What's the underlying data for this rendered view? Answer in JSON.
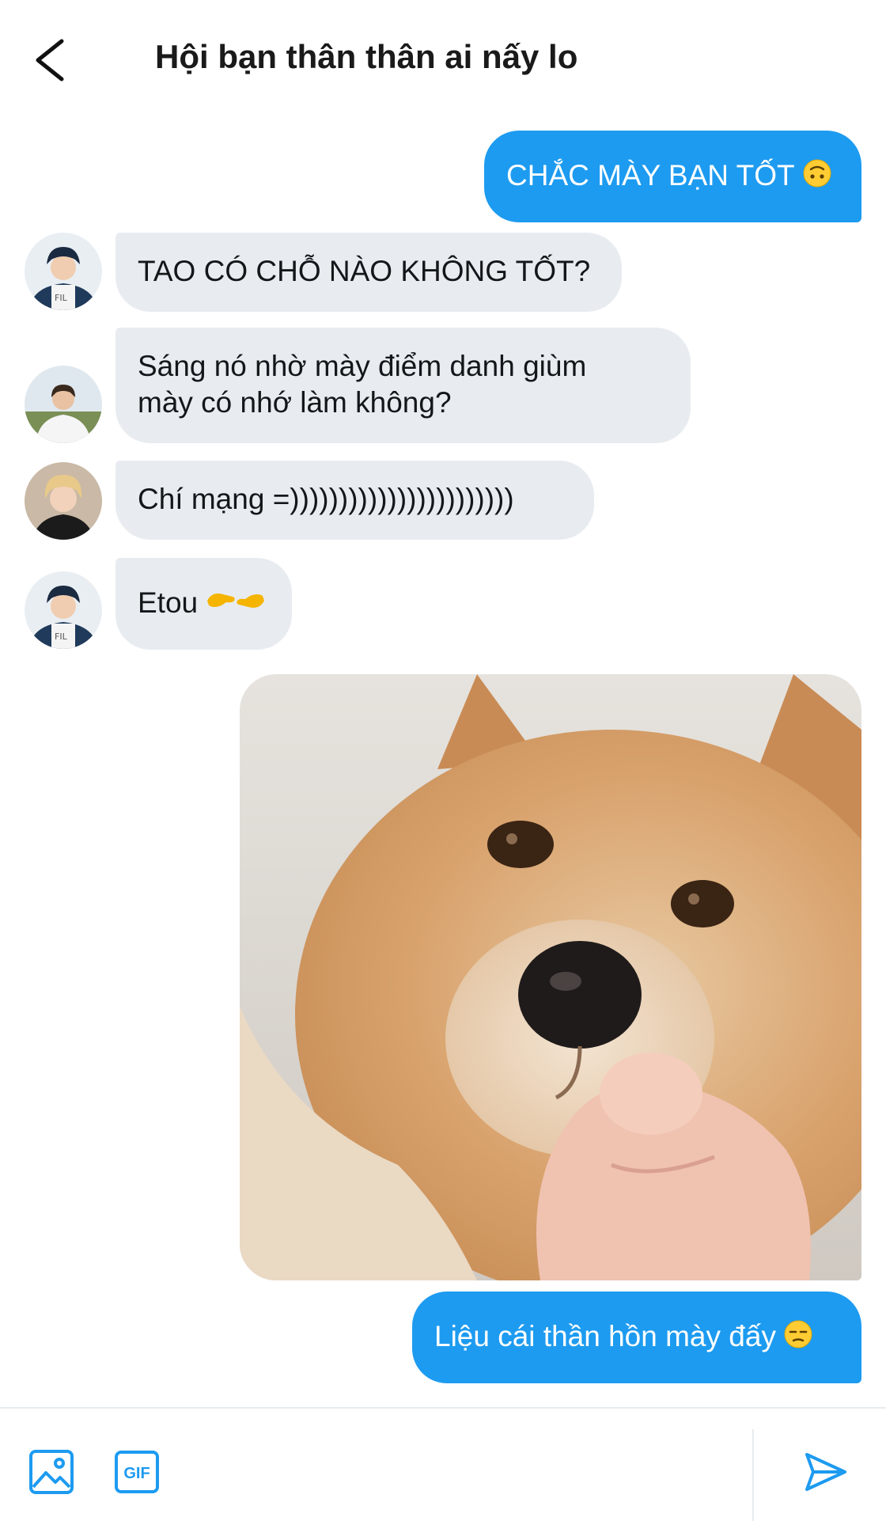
{
  "header": {
    "title": "Hội bạn thân thân ai nấy lo"
  },
  "messages": [
    {
      "sender": "me",
      "text": "CHẮC MÀY BẠN TỐT",
      "emoji": "upside-down-face"
    },
    {
      "sender": "member-1",
      "text": "TAO CÓ CHỖ NÀO KHÔNG TỐT?"
    },
    {
      "sender": "member-2",
      "line1": "Sáng nó nhờ mày điểm danh giùm",
      "line2": "mày có nhớ làm không?"
    },
    {
      "sender": "member-3",
      "text": "Chí mạng =)))))))))))))))))))))))"
    },
    {
      "sender": "member-1",
      "text": "Etou",
      "emoji": "pointing-fingers"
    },
    {
      "sender": "me",
      "type": "image",
      "image": "shiba-dog-pointing-meme"
    },
    {
      "sender": "me",
      "text": "Liệu cái thần hồn mày đấy",
      "emoji": "unamused-face"
    }
  ],
  "composer": {
    "icons": [
      "image-icon",
      "gif-icon",
      "send-icon"
    ],
    "gif_label": "GIF"
  },
  "colors": {
    "accent": "#1d9bf0",
    "incoming_bubble": "#e8ecf0",
    "background": "#ffffff"
  }
}
